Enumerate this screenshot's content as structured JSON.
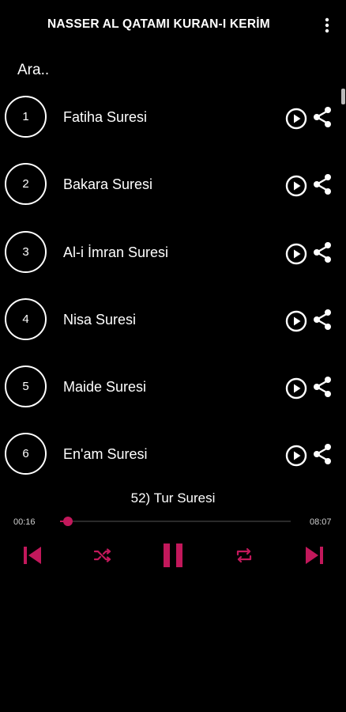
{
  "app": {
    "title": "NASSER AL QATAMI KURAN-I KERİM",
    "menu_icon": "more-vertical-icon"
  },
  "search": {
    "placeholder": "Ara.."
  },
  "surahs": [
    {
      "number": "1",
      "title": "Fatiha Suresi"
    },
    {
      "number": "2",
      "title": "Bakara Suresi"
    },
    {
      "number": "3",
      "title": "Al-i İmran Suresi"
    },
    {
      "number": "4",
      "title": "Nisa Suresi"
    },
    {
      "number": "5",
      "title": "Maide Suresi"
    },
    {
      "number": "6",
      "title": "En'am Suresi"
    }
  ],
  "player": {
    "now_playing": "52) Tur Suresi",
    "current_time": "00:16",
    "duration": "08:07",
    "progress": 0.033,
    "is_playing": true
  },
  "colors": {
    "background": "#000000",
    "accent": "#c2185b",
    "text": "#ffffff"
  }
}
